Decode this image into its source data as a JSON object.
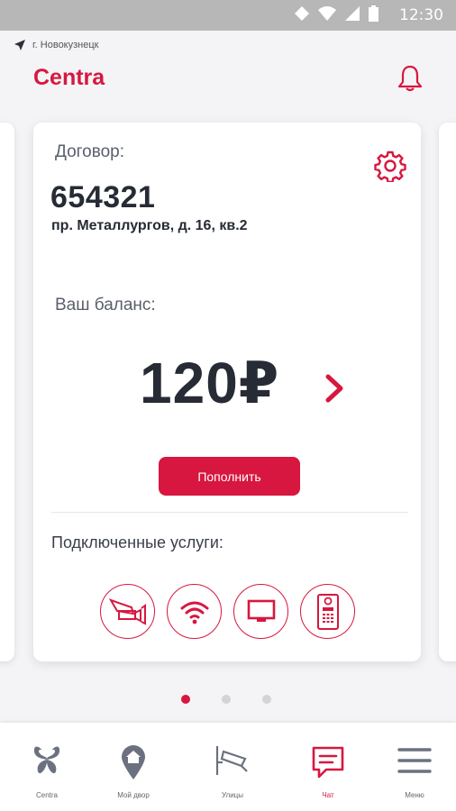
{
  "status_bar": {
    "time": "12:30"
  },
  "header": {
    "location": "г. Новокузнецк",
    "brand": "Centra"
  },
  "card": {
    "contract_label": "Договор:",
    "contract_number": "654321",
    "address": "пр. Металлургов, д. 16, кв.2",
    "balance_label": "Ваш баланс:",
    "balance_amount": "120₽",
    "topup_button": "Пополнить",
    "services_label": "Подключенные услуги:",
    "services": [
      "camera-icon",
      "wifi-icon",
      "tv-icon",
      "intercom-icon"
    ]
  },
  "pagination": {
    "count": 3,
    "active": 0
  },
  "bottom_nav": [
    {
      "label": "Centra",
      "icon": "butterfly-icon"
    },
    {
      "label": "Мой двор",
      "icon": "home-pin-icon"
    },
    {
      "label": "Улицы",
      "icon": "street-camera-icon"
    },
    {
      "label": "Чат",
      "icon": "chat-icon",
      "active": true
    },
    {
      "label": "Меню",
      "icon": "menu-icon"
    }
  ],
  "colors": {
    "accent": "#d7173f",
    "text": "#262b35",
    "muted": "#5a5f6a",
    "background": "#f4f4f6"
  }
}
